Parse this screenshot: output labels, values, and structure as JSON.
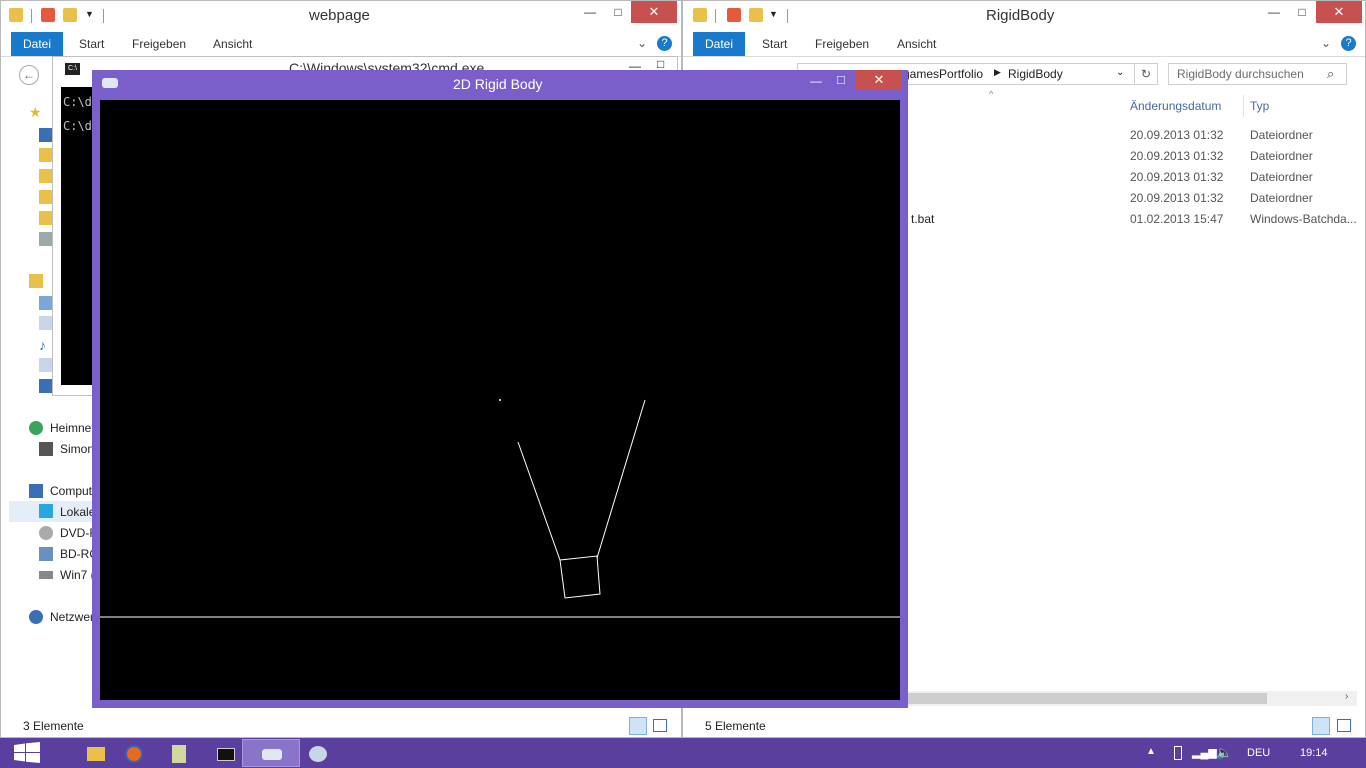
{
  "left_explorer": {
    "title": "webpage",
    "tabs": [
      "Datei",
      "Start",
      "Freigeben",
      "Ansicht"
    ],
    "nav_items": [
      "Heimnet",
      "Simon",
      "Comput",
      "Lokale",
      "DVD-R",
      "BD-RO",
      "Win7 (",
      "Netzwer"
    ],
    "status": "3 Elemente"
  },
  "cmd": {
    "title": "C:\\Windows\\system32\\cmd.exe",
    "lines": [
      "C:\\d",
      "C:\\d"
    ]
  },
  "right_explorer": {
    "title": "RigidBody",
    "tabs": [
      "Datei",
      "Start",
      "Freigeben",
      "Ansicht"
    ],
    "breadcrumb": [
      "gamesPortfolio",
      "RigidBody"
    ],
    "search_placeholder": "RigidBody durchsuchen",
    "columns": [
      "Änderungsdatum",
      "Typ"
    ],
    "rows": [
      {
        "name": "",
        "date": "20.09.2013 01:32",
        "type": "Dateiordner"
      },
      {
        "name": "",
        "date": "20.09.2013 01:32",
        "type": "Dateiordner"
      },
      {
        "name": "",
        "date": "20.09.2013 01:32",
        "type": "Dateiordner"
      },
      {
        "name": "",
        "date": "20.09.2013 01:32",
        "type": "Dateiordner"
      },
      {
        "name": "t.bat",
        "date": "01.02.2013 15:47",
        "type": "Windows-Batchda..."
      }
    ],
    "status": "5 Elemente"
  },
  "rigid_window": {
    "title": "2D Rigid Body",
    "controls": {
      "minimize": "—",
      "maximize": "□",
      "close": "✕"
    }
  },
  "taskbar": {
    "lang": "DEU",
    "time": "19:14"
  },
  "colors": {
    "accent": "#1979ca",
    "rigid_frame": "#7a5fcb",
    "close": "#c75050",
    "taskbar": "#5b3f9e"
  }
}
